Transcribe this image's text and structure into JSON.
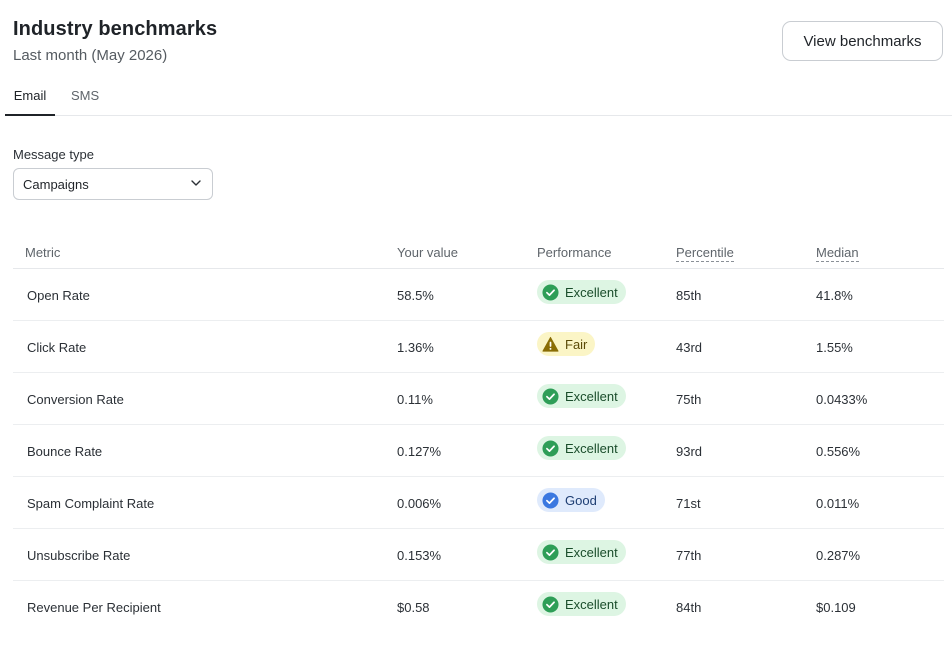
{
  "header": {
    "title": "Industry benchmarks",
    "subtitle": "Last month (May 2026)",
    "view_button_label": "View benchmarks"
  },
  "tabs": [
    {
      "label": "Email",
      "active": true
    },
    {
      "label": "SMS",
      "active": false
    }
  ],
  "filter": {
    "label": "Message type",
    "selected": "Campaigns"
  },
  "table": {
    "columns": [
      "Metric",
      "Your value",
      "Performance",
      "Percentile",
      "Median"
    ],
    "rows": [
      {
        "metric": "Open Rate",
        "value": "58.5%",
        "performance": "Excellent",
        "percentile": "85th",
        "median": "41.8%"
      },
      {
        "metric": "Click Rate",
        "value": "1.36%",
        "performance": "Fair",
        "percentile": "43rd",
        "median": "1.55%"
      },
      {
        "metric": "Conversion Rate",
        "value": "0.11%",
        "performance": "Excellent",
        "percentile": "75th",
        "median": "0.0433%"
      },
      {
        "metric": "Bounce Rate",
        "value": "0.127%",
        "performance": "Excellent",
        "percentile": "93rd",
        "median": "0.556%"
      },
      {
        "metric": "Spam Complaint Rate",
        "value": "0.006%",
        "performance": "Good",
        "percentile": "71st",
        "median": "0.011%"
      },
      {
        "metric": "Unsubscribe Rate",
        "value": "0.153%",
        "performance": "Excellent",
        "percentile": "77th",
        "median": "0.287%"
      },
      {
        "metric": "Revenue Per Recipient",
        "value": "$0.58",
        "performance": "Excellent",
        "percentile": "84th",
        "median": "$0.109"
      }
    ]
  },
  "colors": {
    "excellent_icon": "#2e9e57",
    "fair_icon": "#8a6d05",
    "good_icon": "#3b78e0"
  },
  "icons": {
    "excellent": "check-circle-icon",
    "fair": "warning-triangle-icon",
    "good": "check-circle-icon",
    "select": "chevron-down-icon"
  }
}
